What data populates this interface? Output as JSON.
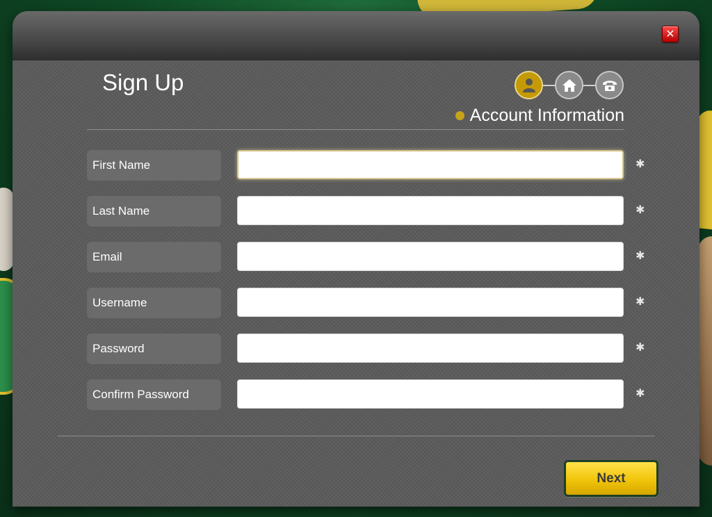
{
  "modal": {
    "title": "Sign Up",
    "close_label": "✕"
  },
  "steps": {
    "current_label": "Account Information",
    "items": [
      {
        "icon": "user-icon",
        "active": true
      },
      {
        "icon": "home-icon",
        "active": false
      },
      {
        "icon": "phone-icon",
        "active": false
      }
    ]
  },
  "fields": [
    {
      "label": "First Name",
      "value": "",
      "placeholder": "",
      "required": "✱",
      "focused": true
    },
    {
      "label": "Last Name",
      "value": "",
      "placeholder": "",
      "required": "✱"
    },
    {
      "label": "Email",
      "value": "",
      "placeholder": "",
      "required": "✱"
    },
    {
      "label": "Username",
      "value": "",
      "placeholder": "",
      "required": "✱"
    },
    {
      "label": "Password",
      "value": "",
      "placeholder": "",
      "required": "✱"
    },
    {
      "label": "Confirm Password",
      "value": "",
      "placeholder": "",
      "required": "✱"
    }
  ],
  "actions": {
    "next_label": "Next"
  },
  "colors": {
    "accent": "#f1c50a",
    "active_step": "#c49a06",
    "panel": "#5a5a5a"
  }
}
